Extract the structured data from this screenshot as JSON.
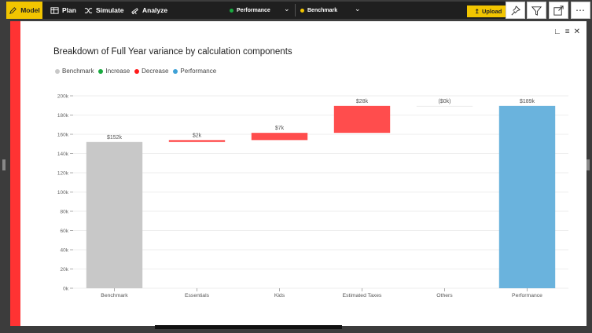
{
  "toolbar": {
    "model": "Model",
    "plan": "Plan",
    "simulate": "Simulate",
    "analyze": "Analyze",
    "selector1": "Performance",
    "selector2": "Benchmark",
    "upload": "Upload"
  },
  "colors": {
    "benchmark": "#c8c8c8",
    "increase": "#1aab40",
    "decrease": "#ff4d4d",
    "performance": "#6ab3dd",
    "accent": "#f2c500"
  },
  "chart_data": {
    "type": "bar",
    "subtype": "waterfall",
    "title": "Breakdown of Full Year variance by calculation components",
    "legend": [
      "Benchmark",
      "Increase",
      "Decrease",
      "Performance"
    ],
    "categories": [
      "Benchmark",
      "Essentials",
      "Kids",
      "Estimated Taxes",
      "Others",
      "Performance"
    ],
    "bars": [
      {
        "category": "Benchmark",
        "kind": "benchmark",
        "start": 0,
        "end": 152,
        "label": "$152k"
      },
      {
        "category": "Essentials",
        "kind": "decrease",
        "start": 152,
        "end": 154,
        "label": "$2k"
      },
      {
        "category": "Kids",
        "kind": "decrease",
        "start": 154,
        "end": 161.5,
        "label": "$7k"
      },
      {
        "category": "Estimated Taxes",
        "kind": "decrease",
        "start": 161.5,
        "end": 189.5,
        "label": "$28k"
      },
      {
        "category": "Others",
        "kind": "decrease",
        "start": 189.5,
        "end": 189.5,
        "label": "($0k)"
      },
      {
        "category": "Performance",
        "kind": "performance",
        "start": 0,
        "end": 189.5,
        "label": "$189k"
      }
    ],
    "yticks": [
      "0k",
      "20k",
      "40k",
      "60k",
      "80k",
      "100k",
      "120k",
      "140k",
      "160k",
      "180k",
      "200k"
    ],
    "ylim": [
      0,
      200
    ],
    "grid": true,
    "legend_position": "top-left"
  }
}
